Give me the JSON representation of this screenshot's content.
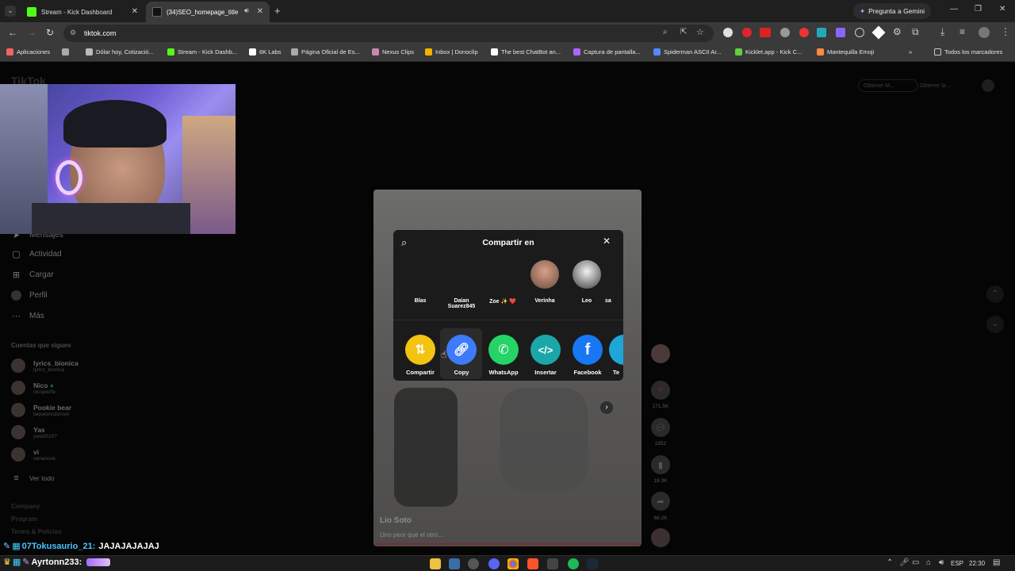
{
  "browser": {
    "tabs": [
      {
        "title": "Stream - Kick Dashboard",
        "active": false
      },
      {
        "title": "(34)SEO_homepage_title",
        "active": true
      }
    ],
    "gemini_label": "Pregunta a Gemini",
    "url": "tiktok.com",
    "bookmarks": [
      "Aplicaciones",
      "Dólar hoy, Cotizació...",
      "Stream - Kick Dashb...",
      "6K Labs",
      "Página Oficial de Es...",
      "Nexus Clips",
      "Inbox | Donoclip",
      "The best ChatBot an...",
      "Captura de pantalla...",
      "Spiderman ASCII Ar...",
      "Kicklet.app - Kick C...",
      "Mantequilla Emoji"
    ],
    "all_bookmarks": "Todos los marcadores"
  },
  "tiktok": {
    "logo": "TikTok",
    "top_right": [
      "Obtener M...",
      "Obtener la ..."
    ],
    "sidebar": [
      {
        "label": "Mensajes",
        "icon": "send-icon"
      },
      {
        "label": "Actividad",
        "icon": "inbox-icon"
      },
      {
        "label": "Cargar",
        "icon": "upload-icon"
      },
      {
        "label": "Perfil",
        "icon": "profile-icon"
      },
      {
        "label": "Más",
        "icon": "more-icon"
      }
    ],
    "following_header": "Cuentas que sigues",
    "following": [
      {
        "name": "lyrics_bionica",
        "handle": "lyrics_bionica"
      },
      {
        "name": "Nico",
        "handle": "nicopezfe"
      },
      {
        "name": "Pookie bear",
        "handle": "laquesncdunsel"
      },
      {
        "name": "Yas",
        "handle": "yasbf0107"
      },
      {
        "name": "vi",
        "handle": "nenancxk"
      }
    ],
    "see_all": "Ver todo",
    "footer_links": [
      "Company",
      "Program",
      "Terms & Policies"
    ],
    "video": {
      "author": "Lio Soto",
      "caption": "Uno peor que el otro..."
    },
    "actions": {
      "likes": "171.5K",
      "comments": "1852",
      "saves": "18.3K",
      "shares": "66.2K"
    }
  },
  "share_modal": {
    "title": "Compartir en",
    "contacts": [
      "Blas",
      "Daian Suarez845",
      "Zoe ✨ ❤️",
      "Verinha",
      "Leo",
      "sa"
    ],
    "options": [
      {
        "label": "Compartir",
        "color": "#f3c312",
        "icon": "repost-icon"
      },
      {
        "label": "Copy",
        "color": "#3e7bfa",
        "icon": "link-icon"
      },
      {
        "label": "WhatsApp",
        "color": "#25d366",
        "icon": "whatsapp-icon"
      },
      {
        "label": "Insertar",
        "color": "#1ba7a7",
        "icon": "embed-icon"
      },
      {
        "label": "Facebook",
        "color": "#1877f2",
        "icon": "facebook-icon"
      },
      {
        "label": "Te",
        "color": "#1fa6d8",
        "icon": "telegram-icon"
      }
    ]
  },
  "chat_overlay": [
    {
      "user": "07Tokusaurio_21:",
      "message": "JAJAJAJAJAJ"
    },
    {
      "user": "Ayrtonn233:",
      "message": ""
    }
  ],
  "taskbar": {
    "language": "ESP",
    "time": "22:30"
  }
}
